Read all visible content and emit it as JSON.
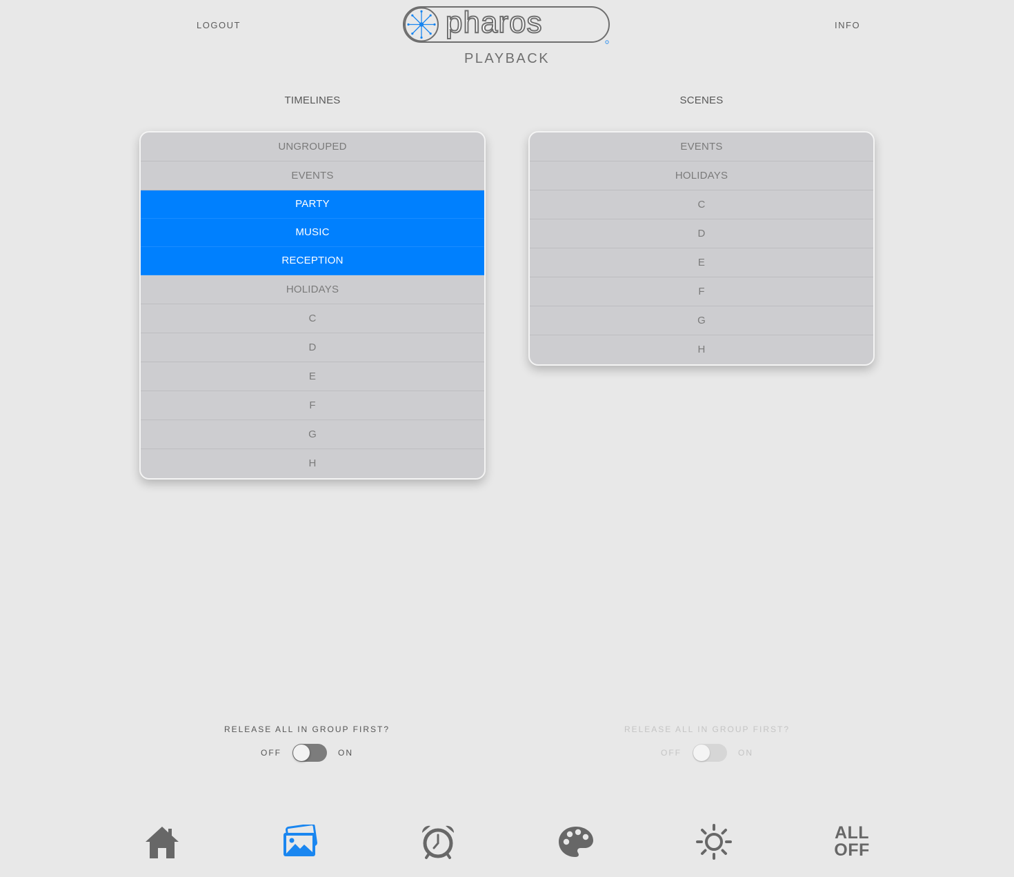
{
  "header": {
    "logout_label": "LOGOUT",
    "info_label": "INFO",
    "logo_text": "pharos",
    "subtitle": "PLAYBACK"
  },
  "timelines": {
    "title": "TIMELINES",
    "items": [
      {
        "label": "UNGROUPED",
        "selected": false
      },
      {
        "label": "EVENTS",
        "selected": false
      },
      {
        "label": "PARTY",
        "selected": true
      },
      {
        "label": "MUSIC",
        "selected": true
      },
      {
        "label": "RECEPTION",
        "selected": true
      },
      {
        "label": "HOLIDAYS",
        "selected": false
      },
      {
        "label": "C",
        "selected": false
      },
      {
        "label": "D",
        "selected": false
      },
      {
        "label": "E",
        "selected": false
      },
      {
        "label": "F",
        "selected": false
      },
      {
        "label": "G",
        "selected": false
      },
      {
        "label": "H",
        "selected": false
      }
    ]
  },
  "scenes": {
    "title": "SCENES",
    "items": [
      {
        "label": "EVENTS",
        "selected": false
      },
      {
        "label": "HOLIDAYS",
        "selected": false
      },
      {
        "label": "C",
        "selected": false
      },
      {
        "label": "D",
        "selected": false
      },
      {
        "label": "E",
        "selected": false
      },
      {
        "label": "F",
        "selected": false
      },
      {
        "label": "G",
        "selected": false
      },
      {
        "label": "H",
        "selected": false
      }
    ]
  },
  "toggles": {
    "timelines_release": {
      "label": "RELEASE ALL IN GROUP FIRST?",
      "off_label": "OFF",
      "on_label": "ON",
      "state": "off",
      "enabled": true
    },
    "scenes_release": {
      "label": "RELEASE ALL IN GROUP FIRST?",
      "off_label": "OFF",
      "on_label": "ON",
      "state": "off",
      "enabled": false
    }
  },
  "nav": {
    "all_off_line1": "ALL",
    "all_off_line2": "OFF",
    "icons": [
      "home-icon",
      "images-icon",
      "alarm-clock-icon",
      "palette-icon",
      "sun-icon",
      "all-off"
    ],
    "active": "images-icon"
  },
  "colors": {
    "accent": "#0080fe",
    "background": "#e8e8e8",
    "list_bg": "#cdcdd0",
    "icon_gray": "#676767"
  }
}
